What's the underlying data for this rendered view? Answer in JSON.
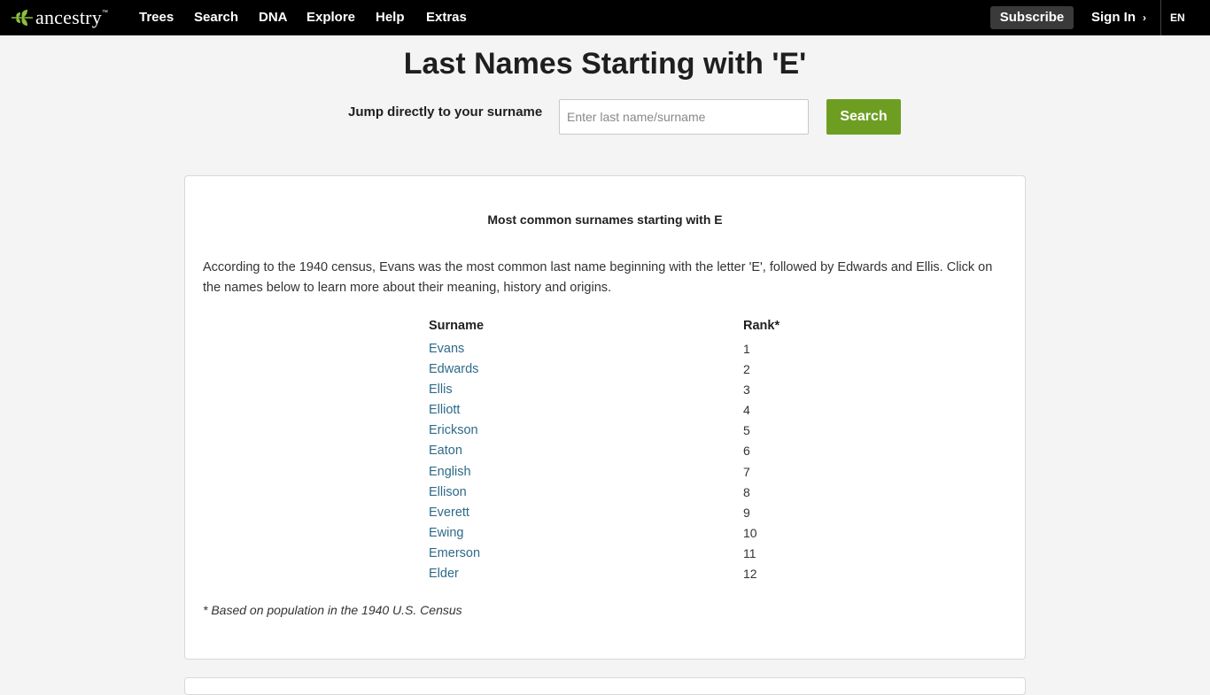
{
  "nav": {
    "logo_text": "ancestry",
    "logo_tm": "™",
    "items": [
      {
        "label": "Trees"
      },
      {
        "label": "Search"
      },
      {
        "label": "DNA"
      },
      {
        "label": "Explore"
      },
      {
        "label": "Help"
      },
      {
        "label": "Extras"
      }
    ],
    "subscribe": "Subscribe",
    "sign_in": "Sign In",
    "language": "EN"
  },
  "page": {
    "title": "Last Names Starting with 'E'",
    "jump_label": "Jump directly to your surname",
    "search_placeholder": "Enter last name/surname",
    "search_button": "Search"
  },
  "card": {
    "heading": "Most common surnames starting with E",
    "intro": "According to the 1940 census, Evans was the most common last name beginning with the letter 'E', followed by Edwards and Ellis. Click on the names below to learn more about their meaning, history and origins.",
    "col_surname": "Surname",
    "col_rank": "Rank*",
    "rows": [
      {
        "name": "Evans",
        "rank": "1"
      },
      {
        "name": "Edwards",
        "rank": "2"
      },
      {
        "name": "Ellis",
        "rank": "3"
      },
      {
        "name": "Elliott",
        "rank": "4"
      },
      {
        "name": "Erickson",
        "rank": "5"
      },
      {
        "name": "Eaton",
        "rank": "6"
      },
      {
        "name": "English",
        "rank": "7"
      },
      {
        "name": "Ellison",
        "rank": "8"
      },
      {
        "name": "Everett",
        "rank": "9"
      },
      {
        "name": "Ewing",
        "rank": "10"
      },
      {
        "name": "Emerson",
        "rank": "11"
      },
      {
        "name": "Elder",
        "rank": "12"
      }
    ],
    "footnote": "* Based on population in the 1940 U.S. Census"
  },
  "colors": {
    "nav_bg": "#000000",
    "search_button": "#6d9e22",
    "link": "#2e6a8a",
    "logo_leaf": "#8cbf3f"
  }
}
